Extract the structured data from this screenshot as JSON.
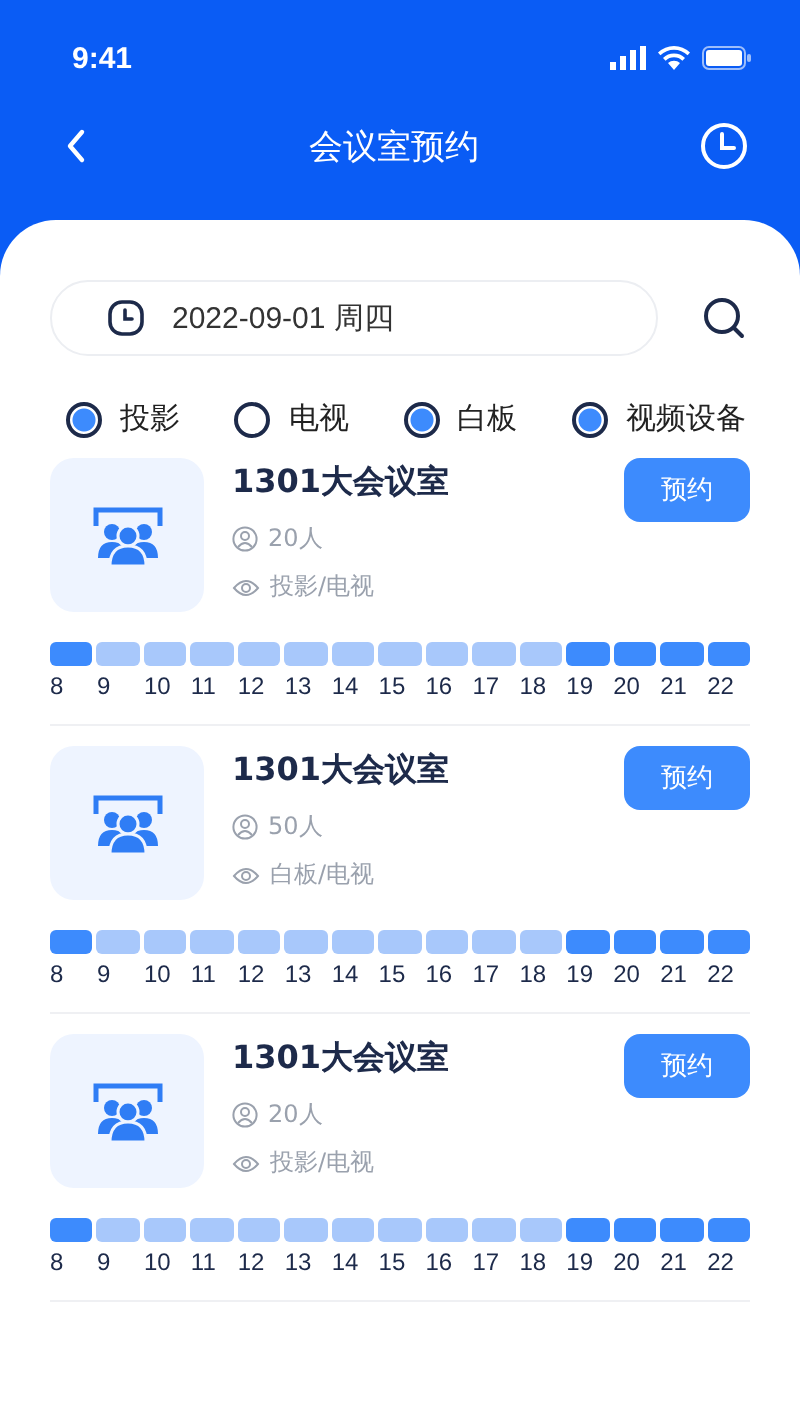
{
  "status_bar": {
    "time": "9:41"
  },
  "header": {
    "title": "会议室预约"
  },
  "date_field": {
    "value": "2022-09-01 周四"
  },
  "filters": [
    {
      "label": "投影",
      "checked": true
    },
    {
      "label": "电视",
      "checked": false
    },
    {
      "label": "白板",
      "checked": true
    },
    {
      "label": "视频设备",
      "checked": true
    }
  ],
  "rooms": [
    {
      "name": "1301大会议室",
      "capacity": "20人",
      "equipment": "投影/电视",
      "button": "预约",
      "slots": [
        {
          "hour": "8",
          "booked": true
        },
        {
          "hour": "9",
          "booked": false
        },
        {
          "hour": "10",
          "booked": false
        },
        {
          "hour": "11",
          "booked": false
        },
        {
          "hour": "12",
          "booked": false
        },
        {
          "hour": "13",
          "booked": false
        },
        {
          "hour": "14",
          "booked": false
        },
        {
          "hour": "15",
          "booked": false
        },
        {
          "hour": "16",
          "booked": false
        },
        {
          "hour": "17",
          "booked": false
        },
        {
          "hour": "18",
          "booked": false
        },
        {
          "hour": "19",
          "booked": true
        },
        {
          "hour": "20",
          "booked": true
        },
        {
          "hour": "21",
          "booked": true
        },
        {
          "hour": "22",
          "booked": true
        }
      ]
    },
    {
      "name": "1301大会议室",
      "capacity": "50人",
      "equipment": "白板/电视",
      "button": "预约",
      "slots": [
        {
          "hour": "8",
          "booked": true
        },
        {
          "hour": "9",
          "booked": false
        },
        {
          "hour": "10",
          "booked": false
        },
        {
          "hour": "11",
          "booked": false
        },
        {
          "hour": "12",
          "booked": false
        },
        {
          "hour": "13",
          "booked": false
        },
        {
          "hour": "14",
          "booked": false
        },
        {
          "hour": "15",
          "booked": false
        },
        {
          "hour": "16",
          "booked": false
        },
        {
          "hour": "17",
          "booked": false
        },
        {
          "hour": "18",
          "booked": false
        },
        {
          "hour": "19",
          "booked": true
        },
        {
          "hour": "20",
          "booked": true
        },
        {
          "hour": "21",
          "booked": true
        },
        {
          "hour": "22",
          "booked": true
        }
      ]
    },
    {
      "name": "1301大会议室",
      "capacity": "20人",
      "equipment": "投影/电视",
      "button": "预约",
      "slots": [
        {
          "hour": "8",
          "booked": true
        },
        {
          "hour": "9",
          "booked": false
        },
        {
          "hour": "10",
          "booked": false
        },
        {
          "hour": "11",
          "booked": false
        },
        {
          "hour": "12",
          "booked": false
        },
        {
          "hour": "13",
          "booked": false
        },
        {
          "hour": "14",
          "booked": false
        },
        {
          "hour": "15",
          "booked": false
        },
        {
          "hour": "16",
          "booked": false
        },
        {
          "hour": "17",
          "booked": false
        },
        {
          "hour": "18",
          "booked": false
        },
        {
          "hour": "19",
          "booked": true
        },
        {
          "hour": "20",
          "booked": true
        },
        {
          "hour": "21",
          "booked": true
        },
        {
          "hour": "22",
          "booked": true
        }
      ]
    }
  ]
}
